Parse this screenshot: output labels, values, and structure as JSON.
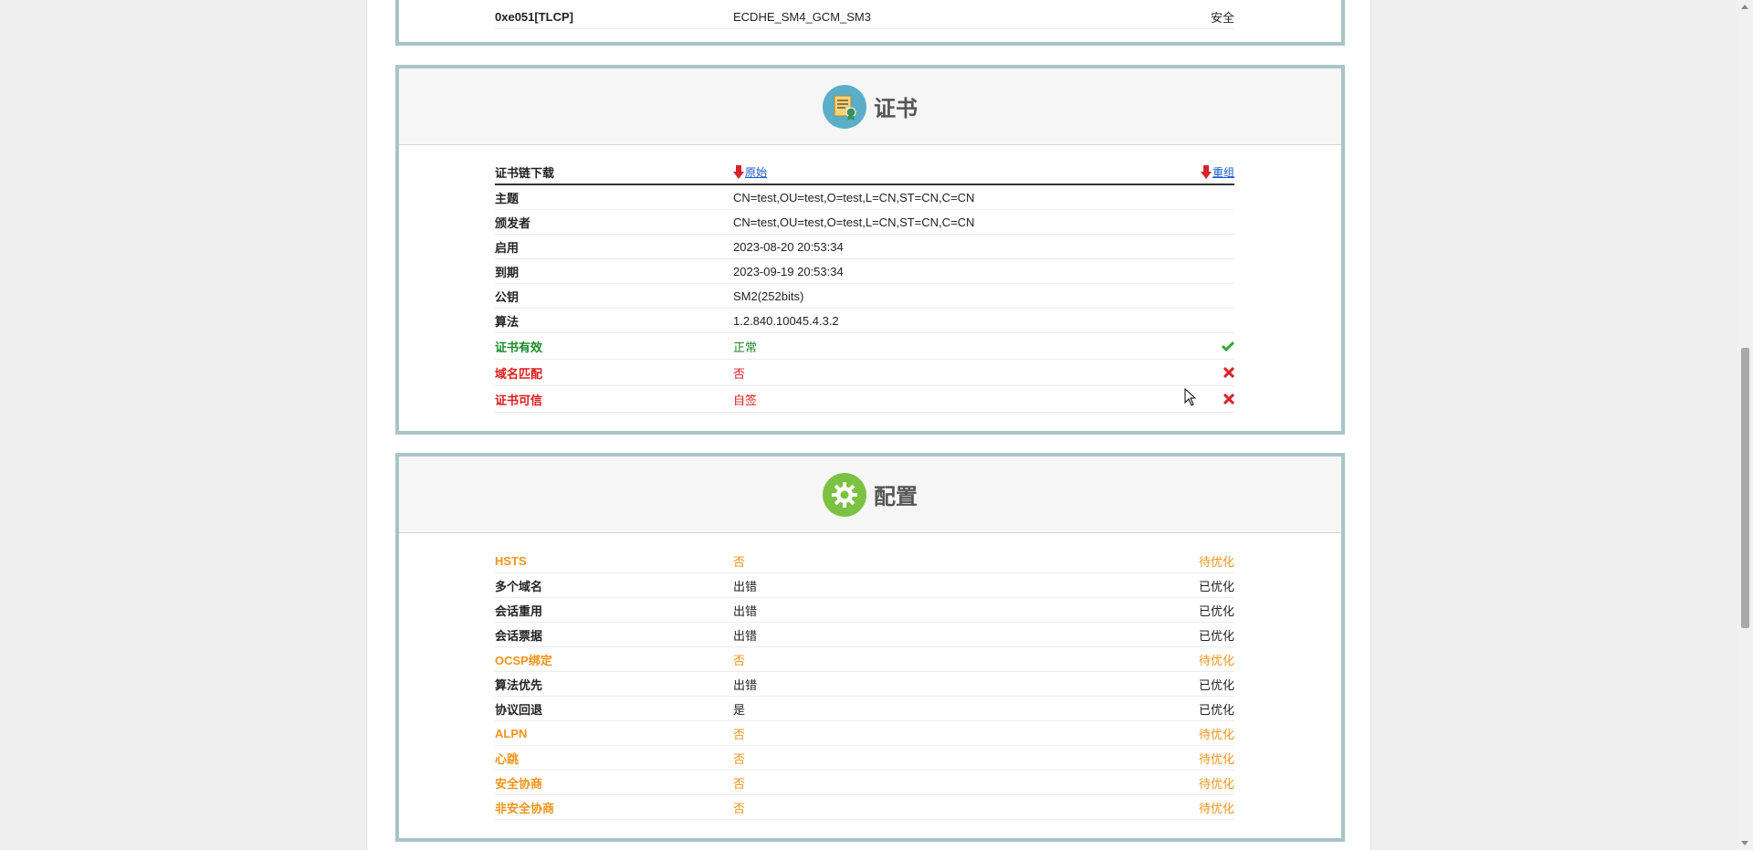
{
  "cipher_tail": {
    "id": "0xe051[TLCP]",
    "name": "ECDHE_SM4_GCM_SM3",
    "status": "安全"
  },
  "certificate": {
    "title": "证书",
    "icon": "certificate-icon",
    "chain_label": "证书链下载",
    "download_original": "原始",
    "download_reorganized": "重组",
    "rows": [
      {
        "label": "主题",
        "value": "CN=test,OU=test,O=test,L=CN,ST=CN,C=CN"
      },
      {
        "label": "颁发者",
        "value": "CN=test,OU=test,O=test,L=CN,ST=CN,C=CN"
      },
      {
        "label": "启用",
        "value": "2023-08-20 20:53:34"
      },
      {
        "label": "到期",
        "value": "2023-09-19 20:53:34"
      },
      {
        "label": "公钥",
        "value": "SM2(252bits)"
      },
      {
        "label": "算法",
        "value": "1.2.840.10045.4.3.2"
      }
    ],
    "checks": [
      {
        "label": "证书有效",
        "value": "正常",
        "status": "ok",
        "icon": "check-icon"
      },
      {
        "label": "域名匹配",
        "value": "否",
        "status": "bad",
        "icon": "cross-icon"
      },
      {
        "label": "证书可信",
        "value": "自签",
        "status": "bad",
        "icon": "cross-icon"
      }
    ]
  },
  "config": {
    "title": "配置",
    "icon": "gear-icon",
    "rows": [
      {
        "label": "HSTS",
        "value": "否",
        "result": "待优化",
        "status": "warn"
      },
      {
        "label": "多个域名",
        "value": "出错",
        "result": "已优化",
        "status": "normal"
      },
      {
        "label": "会话重用",
        "value": "出错",
        "result": "已优化",
        "status": "normal"
      },
      {
        "label": "会话票据",
        "value": "出错",
        "result": "已优化",
        "status": "normal"
      },
      {
        "label": "OCSP绑定",
        "value": "否",
        "result": "待优化",
        "status": "warn"
      },
      {
        "label": "算法优先",
        "value": "出错",
        "result": "已优化",
        "status": "normal"
      },
      {
        "label": "协议回退",
        "value": "是",
        "result": "已优化",
        "status": "normal"
      },
      {
        "label": "ALPN",
        "value": "否",
        "result": "待优化",
        "status": "warn"
      },
      {
        "label": "心跳",
        "value": "否",
        "result": "待优化",
        "status": "warn"
      },
      {
        "label": "安全协商",
        "value": "否",
        "result": "待优化",
        "status": "warn"
      },
      {
        "label": "非安全协商",
        "value": "否",
        "result": "待优化",
        "status": "warn"
      }
    ]
  },
  "colors": {
    "section_border": "#a9c4c6",
    "ok": "#1a8a2a",
    "bad": "#e01b1b",
    "warn": "#f2931b",
    "link": "#1a5bd0"
  }
}
